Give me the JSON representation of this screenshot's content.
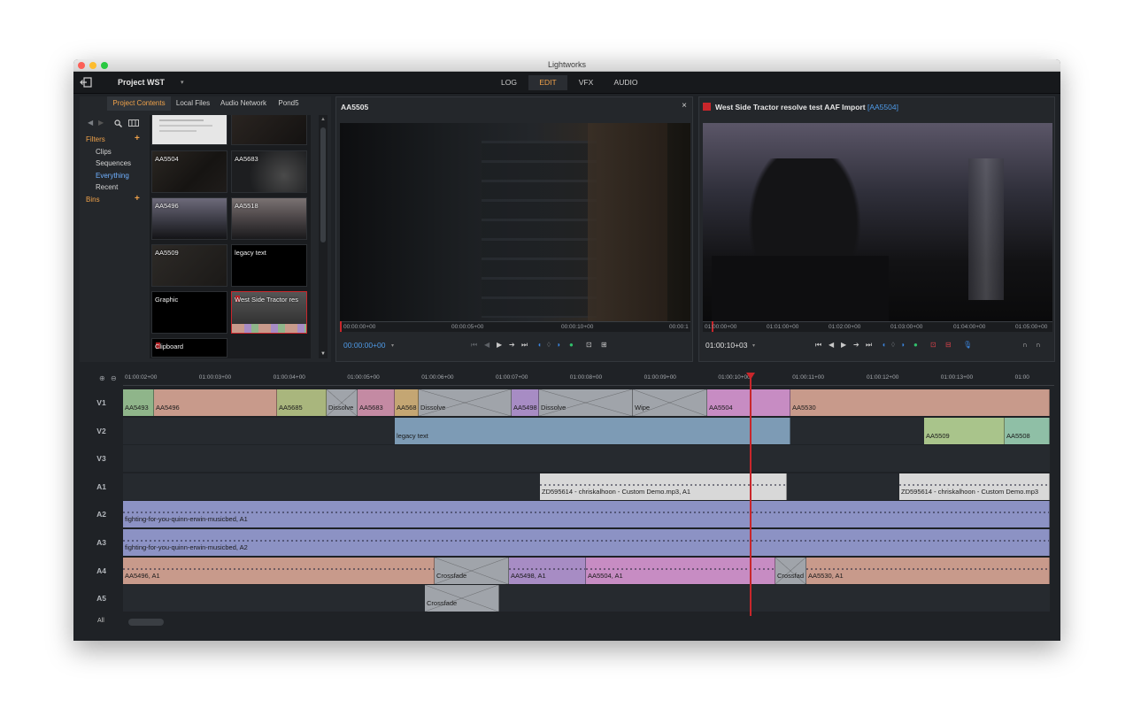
{
  "window": {
    "title": "Lightworks"
  },
  "topbar": {
    "project_name": "Project WST",
    "project_dropdown": "▾",
    "rooms": [
      {
        "label": "LOG",
        "active": false
      },
      {
        "label": "EDIT",
        "active": true
      },
      {
        "label": "VFX",
        "active": false
      },
      {
        "label": "AUDIO",
        "active": false
      }
    ]
  },
  "content_panel": {
    "tabs": [
      {
        "label": "Project Contents",
        "active": true
      },
      {
        "label": "Local Files",
        "active": false
      },
      {
        "label": "Audio Network",
        "active": false
      },
      {
        "label": "Pond5",
        "active": false
      }
    ],
    "filters_label": "Filters",
    "filters": [
      {
        "label": "Clips",
        "active": false
      },
      {
        "label": "Sequences",
        "active": false
      },
      {
        "label": "Everything",
        "active": true
      },
      {
        "label": "Recent",
        "active": false
      }
    ],
    "bins_label": "Bins",
    "clips": [
      {
        "label": "",
        "type": "document"
      },
      {
        "label": "",
        "type": "dark"
      },
      {
        "label": "AA5504",
        "type": "dark"
      },
      {
        "label": "AA5683",
        "type": "night"
      },
      {
        "label": "AA5496",
        "type": "dusk"
      },
      {
        "label": "AA5518",
        "type": "dusk"
      },
      {
        "label": "AA5509",
        "type": "dark"
      },
      {
        "label": "legacy text",
        "type": "black"
      },
      {
        "label": "Graphic",
        "type": "black"
      },
      {
        "label": "West Side Tractor res",
        "type": "sequence"
      },
      {
        "label": "Clipboard",
        "type": "clipboard"
      }
    ]
  },
  "source_viewer": {
    "title": "AA5505",
    "close": "×",
    "ruler": [
      "00:00:00+00",
      "00:00:05+00",
      "00:00:10+00",
      "00:00:1"
    ],
    "timecode": "00:00:00+00",
    "tc_dropdown": "▾"
  },
  "record_viewer": {
    "title": "West Side Tractor resolve test AAF Import",
    "tag": "[AA5504]",
    "ruler": [
      "01:00:00+00",
      "01:01:00+00",
      "01:02:00+00",
      "01:03:00+00",
      "01:04:00+00",
      "01:05:00+00"
    ],
    "timecode": "01:00:10+03",
    "tc_dropdown": "▾"
  },
  "timeline": {
    "ruler": [
      "01:00:02+00",
      "01:00:03+00",
      "01:00:04+00",
      "01:00:05+00",
      "01:00:06+00",
      "01:00:07+00",
      "01:00:08+00",
      "01:00:09+00",
      "01:00:10+00",
      "01:00:11+00",
      "01:00:12+00",
      "01:00:13+00",
      "01:00"
    ],
    "tracks": [
      {
        "name": "V1",
        "segments": [
          {
            "label": "AA5493",
            "start": 0,
            "end": 35,
            "color": "#8fb58a"
          },
          {
            "label": "AA5496",
            "start": 35,
            "end": 174,
            "color": "#c89a8b"
          },
          {
            "label": "AA5685",
            "start": 174,
            "end": 230,
            "color": "#a9b67d"
          },
          {
            "label": "Dissolve",
            "start": 230,
            "end": 265,
            "color": "xfade"
          },
          {
            "label": "AA5683",
            "start": 265,
            "end": 307,
            "color": "#c48aa3"
          },
          {
            "label": "AA568",
            "start": 307,
            "end": 334,
            "color": "#c4a673"
          },
          {
            "label": "Dissolve",
            "start": 334,
            "end": 439,
            "color": "xfade"
          },
          {
            "label": "AA5498",
            "start": 439,
            "end": 470,
            "color": "#a78cc4"
          },
          {
            "label": "Dissolve",
            "start": 470,
            "end": 576,
            "color": "xfade"
          },
          {
            "label": "Wipe",
            "start": 576,
            "end": 660,
            "color": "xfade"
          },
          {
            "label": "AA5504",
            "start": 660,
            "end": 754,
            "color": "#c78cc3"
          },
          {
            "label": "AA5530",
            "start": 754,
            "end": 1047,
            "color": "#c89a8b"
          }
        ]
      },
      {
        "name": "V2",
        "segments": [
          {
            "label": "legacy text",
            "start": 307,
            "end": 754,
            "color": "#7d9bb5"
          },
          {
            "label": "AA5509",
            "start": 905,
            "end": 996,
            "color": "#a9c48b"
          },
          {
            "label": "AA5508",
            "start": 996,
            "end": 1047,
            "color": "#8fbfa6"
          }
        ]
      },
      {
        "name": "V3",
        "segments": []
      },
      {
        "name": "A1",
        "segments": [
          {
            "label": "ZD595614 - chriskalhoon - Custom Demo.mp3, A1",
            "start": 471,
            "end": 750,
            "color": "#d8d8d8"
          },
          {
            "label": "ZD595614 - chriskalhoon - Custom Demo.mp3",
            "start": 877,
            "end": 1047,
            "color": "#d8d8d8"
          }
        ]
      },
      {
        "name": "A2",
        "segments": [
          {
            "label": "fighting-for-you-quinn-erwin-musicbed, A1",
            "start": 0,
            "end": 1047,
            "color": "#8c92c4"
          }
        ]
      },
      {
        "name": "A3",
        "segments": [
          {
            "label": "fighting-for-you-quinn-erwin-musicbed, A2",
            "start": 0,
            "end": 1047,
            "color": "#8c92c4"
          }
        ]
      },
      {
        "name": "A4",
        "segments": [
          {
            "label": "AA5496, A1",
            "start": 0,
            "end": 352,
            "color": "#c89a8b"
          },
          {
            "label": "Crossfade",
            "start": 352,
            "end": 436,
            "color": "xfade"
          },
          {
            "label": "AA5498, A1",
            "start": 436,
            "end": 523,
            "color": "#a78cc4"
          },
          {
            "label": "AA5504, A1",
            "start": 523,
            "end": 737,
            "color": "#c78cc3"
          },
          {
            "label": "Crossfad",
            "start": 737,
            "end": 772,
            "color": "xfade"
          },
          {
            "label": "AA5530, A1",
            "start": 772,
            "end": 1047,
            "color": "#c89a8b"
          }
        ]
      },
      {
        "name": "A5",
        "segments": [
          {
            "label": "Crossfade",
            "start": 341,
            "end": 425,
            "color": "xfade"
          }
        ]
      }
    ],
    "all_label": "All"
  }
}
